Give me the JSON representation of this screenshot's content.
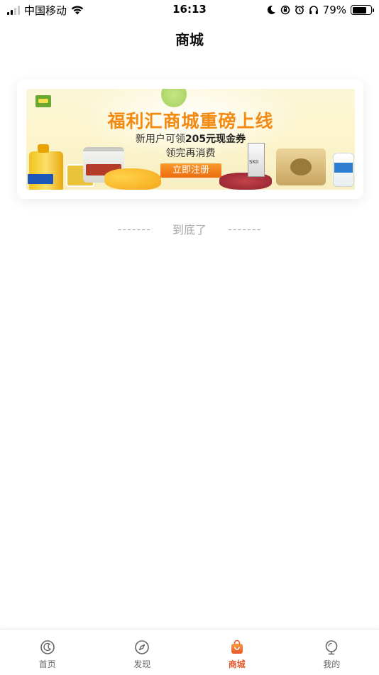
{
  "status_bar": {
    "carrier": "中国移动",
    "time": "16:13",
    "battery_percent": "79%",
    "battery_level": 0.79
  },
  "nav": {
    "title": "商城"
  },
  "banner": {
    "headline": "福利汇商城重磅上线",
    "sub_prefix": "新用户可领",
    "sub_amount": "205元现金券",
    "sub_line2": "领完再消费",
    "cta": "立即注册",
    "product_skii": "SKII"
  },
  "list_end": {
    "dash_left": "-------",
    "text": "到底了",
    "dash_right": "-------"
  },
  "tabbar": {
    "tabs": [
      {
        "label": "首页",
        "icon": "home-icon"
      },
      {
        "label": "发现",
        "icon": "compass-icon"
      },
      {
        "label": "商城",
        "icon": "shopping-bag-icon",
        "active": true
      },
      {
        "label": "我的",
        "icon": "profile-icon"
      }
    ],
    "active_color": "#e5562b",
    "inactive_color": "#666666"
  }
}
